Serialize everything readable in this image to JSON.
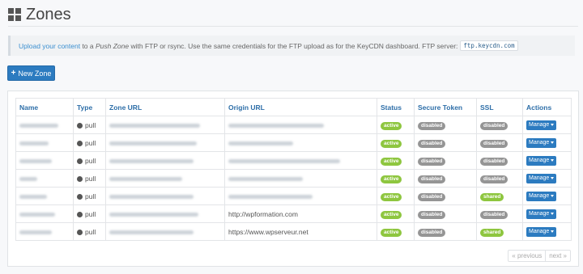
{
  "page": {
    "title": "Zones",
    "title_icon": "grid-icon"
  },
  "info": {
    "link_text": "Upload your content",
    "text1": " to a ",
    "push_zone": "Push Zone",
    "text2": " with FTP or rsync. Use the same credentials for the FTP upload as for the KeyCDN dashboard. FTP server:",
    "ftp_server": "ftp.keycdn.com"
  },
  "new_zone_button": {
    "icon": "plus-icon",
    "label": "New Zone"
  },
  "table": {
    "headers": [
      "Name",
      "Type",
      "Zone URL",
      "Origin URL",
      "Status",
      "Secure Token",
      "SSL",
      "Actions"
    ],
    "rows": [
      {
        "type": "pull",
        "origin_url": "",
        "status": "active",
        "secure_token": "disabled",
        "ssl": "disabled",
        "action": "Manage"
      },
      {
        "type": "pull",
        "origin_url": "",
        "status": "active",
        "secure_token": "disabled",
        "ssl": "disabled",
        "action": "Manage"
      },
      {
        "type": "pull",
        "origin_url": "",
        "status": "active",
        "secure_token": "disabled",
        "ssl": "disabled",
        "action": "Manage"
      },
      {
        "type": "pull",
        "origin_url": "",
        "status": "active",
        "secure_token": "disabled",
        "ssl": "disabled",
        "action": "Manage"
      },
      {
        "type": "pull",
        "origin_url": "",
        "status": "active",
        "secure_token": "disabled",
        "ssl": "shared",
        "action": "Manage"
      },
      {
        "type": "pull",
        "origin_url": "http://wpformation.com",
        "status": "active",
        "secure_token": "disabled",
        "ssl": "disabled",
        "action": "Manage"
      },
      {
        "type": "pull",
        "origin_url": "https://www.wpserveur.net",
        "status": "active",
        "secure_token": "disabled",
        "ssl": "shared",
        "action": "Manage"
      }
    ]
  },
  "pagination": {
    "previous": "« previous",
    "next": "next »"
  },
  "colors": {
    "accent": "#2c7bc0",
    "active": "#8ec63f",
    "disabled": "#959595",
    "shared": "#8ec63f"
  }
}
